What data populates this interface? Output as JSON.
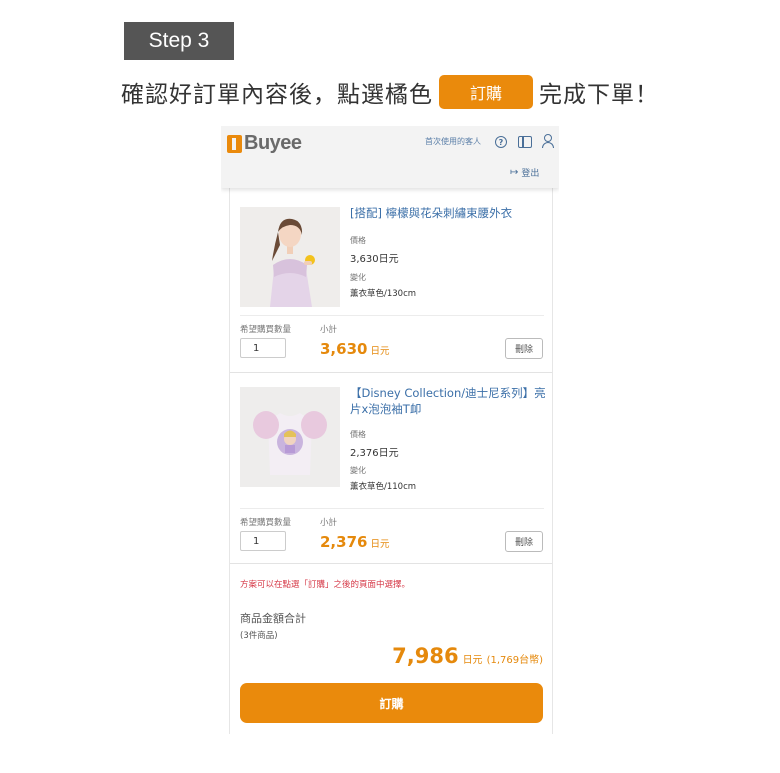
{
  "step_label": "Step 3",
  "instruction": {
    "before": "確認好訂單內容後，點選橘色",
    "button": "訂購",
    "after": "完成下單！"
  },
  "header": {
    "logo_text": "Buyee",
    "first_time_link": "首次使用的客人",
    "help_icon": "?",
    "logout_label": "登出"
  },
  "items": [
    {
      "name": "[搭配] 檸檬與花朵刺繡束腰外衣",
      "price_label": "價格",
      "price": "3,630日元",
      "variant_label": "變化",
      "variant": "薰衣草色/130cm",
      "qty_label": "希望購買數量",
      "qty": "1",
      "subtotal_label": "小計",
      "subtotal": "3,630",
      "unit": "日元",
      "delete_label": "刪除"
    },
    {
      "name": "【Disney Collection/迪士尼系列】亮片x泡泡袖T卹",
      "price_label": "價格",
      "price": "2,376日元",
      "variant_label": "變化",
      "variant": "薰衣草色/110cm",
      "qty_label": "希望購買數量",
      "qty": "1",
      "subtotal_label": "小計",
      "subtotal": "2,376",
      "unit": "日元",
      "delete_label": "刪除"
    }
  ],
  "summary": {
    "notice": "方案可以在點選「訂購」之後的頁面中選擇。",
    "total_label": "商品金額合計",
    "count": "(3件商品)",
    "total": "7,986",
    "unit": "日元",
    "twd": "(1,769台幣)",
    "order_button": "訂購"
  },
  "colors": {
    "accent": "#ea8a0c",
    "price": "#e5890c",
    "link": "#3b6fa8",
    "notice": "#d63a48",
    "badge": "#555555"
  }
}
